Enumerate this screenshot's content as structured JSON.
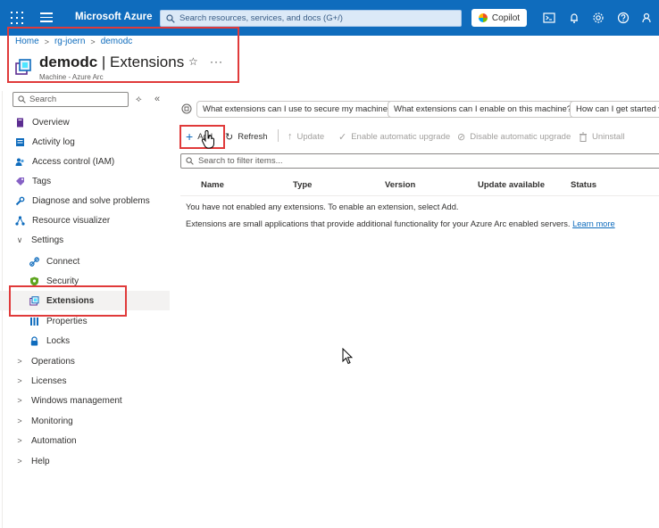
{
  "topbar": {
    "brand": "Microsoft Azure",
    "search_placeholder": "Search resources, services, and docs (G+/)",
    "copilot_label": "Copilot",
    "accent": "#0f6cbd"
  },
  "breadcrumb": [
    "Home",
    "rg-joern",
    "demodc"
  ],
  "header": {
    "title_resource": "demodc",
    "title_section": "| Extensions",
    "subtitle": "Machine - Azure Arc"
  },
  "sidebar": {
    "search_placeholder": "Search",
    "items": [
      {
        "label": "Overview",
        "icon": "machine-icon"
      },
      {
        "label": "Activity log",
        "icon": "activity-log-icon"
      },
      {
        "label": "Access control (IAM)",
        "icon": "people-icon"
      },
      {
        "label": "Tags",
        "icon": "tag-icon"
      },
      {
        "label": "Diagnose and solve problems",
        "icon": "wrench-icon"
      },
      {
        "label": "Resource visualizer",
        "icon": "graph-icon"
      },
      {
        "label": "Settings",
        "icon": "chevron-down-icon"
      },
      {
        "label": "Connect",
        "icon": "link-icon"
      },
      {
        "label": "Security",
        "icon": "shield-icon"
      },
      {
        "label": "Extensions",
        "icon": "extension-icon"
      },
      {
        "label": "Properties",
        "icon": "properties-icon"
      },
      {
        "label": "Locks",
        "icon": "lock-icon"
      },
      {
        "label": "Operations",
        "icon": "chevron-right-icon"
      },
      {
        "label": "Licenses",
        "icon": "chevron-right-icon"
      },
      {
        "label": "Windows management",
        "icon": "chevron-right-icon"
      },
      {
        "label": "Monitoring",
        "icon": "chevron-right-icon"
      },
      {
        "label": "Automation",
        "icon": "chevron-right-icon"
      },
      {
        "label": "Help",
        "icon": "chevron-right-icon"
      }
    ]
  },
  "suggestions": [
    "What extensions can I use to secure my machine?",
    "What extensions can I enable on this machine?",
    "How can I get started w"
  ],
  "toolbar": {
    "add": "Add",
    "refresh": "Refresh",
    "update": "Update",
    "enable_auto": "Enable automatic upgrade",
    "disable_auto": "Disable automatic upgrade",
    "uninstall": "Uninstall"
  },
  "filter_placeholder": "Search to filter items...",
  "table": {
    "columns": [
      "Name",
      "Type",
      "Version",
      "Update available",
      "Status"
    ]
  },
  "messages": {
    "empty": "You have not enabled any extensions. To enable an extension, select Add.",
    "info": "Extensions are small applications that provide additional functionality for your Azure Arc enabled servers.",
    "learn_more": "Learn more"
  }
}
